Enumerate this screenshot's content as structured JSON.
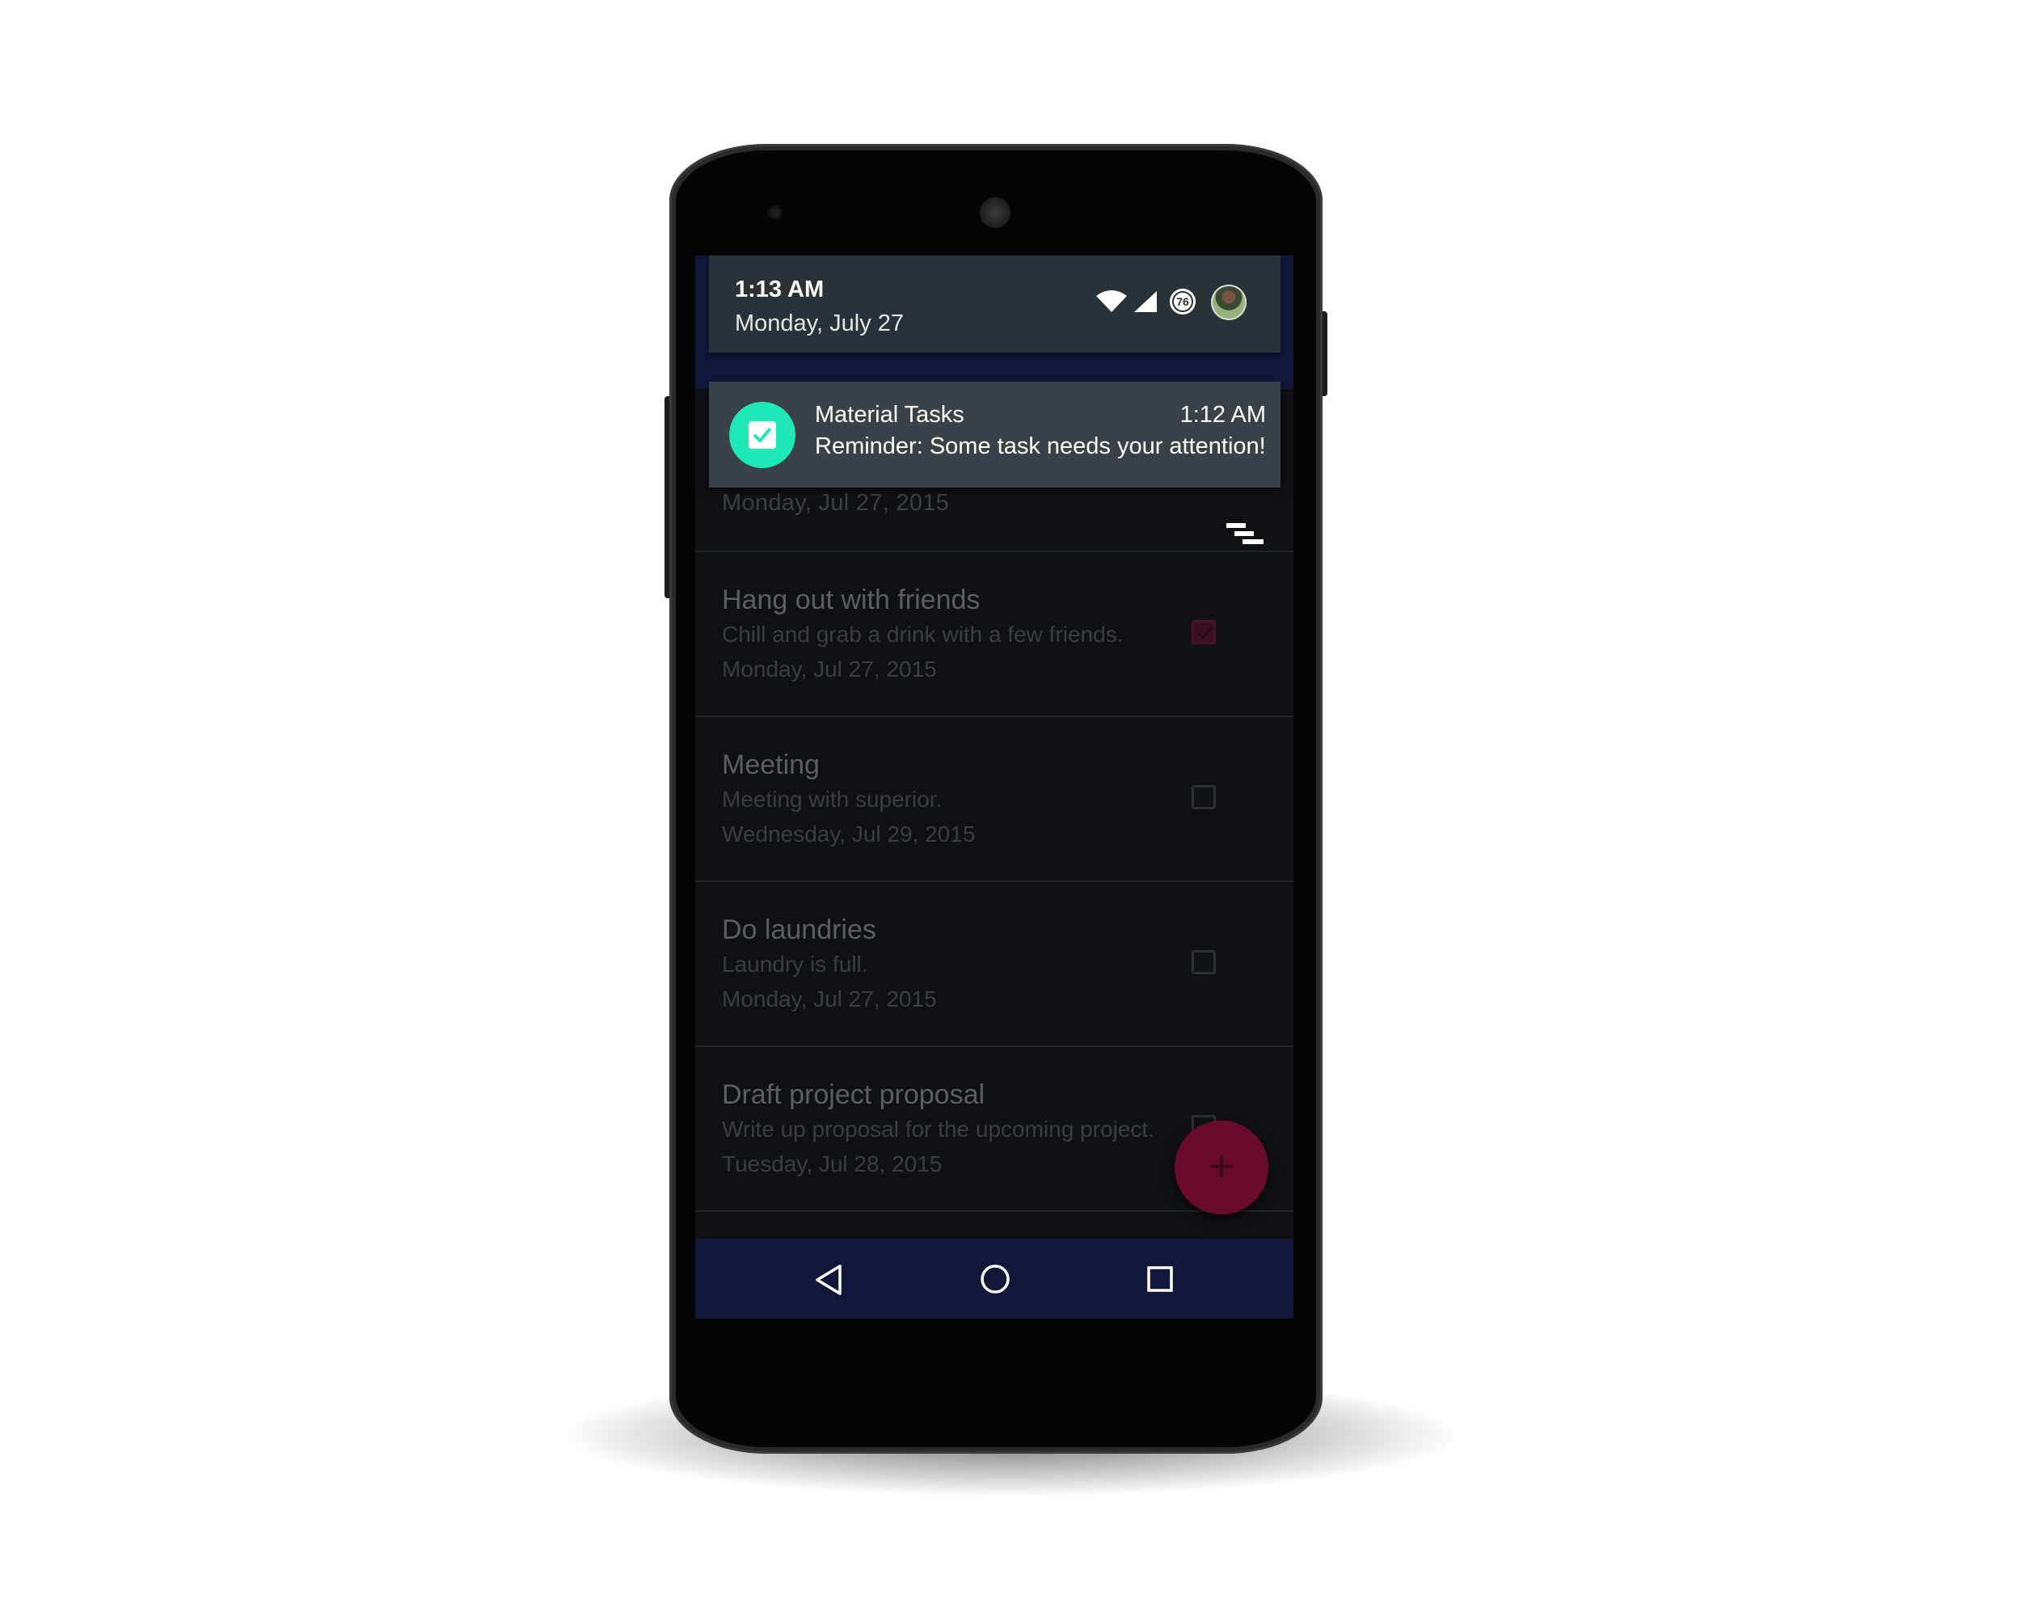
{
  "status_header": {
    "time": "1:13 AM",
    "date": "Monday, July 27",
    "battery_level": "76",
    "icons": [
      "wifi-icon",
      "cell-signal-icon",
      "battery-icon",
      "user-avatar"
    ]
  },
  "notification": {
    "app_name": "Material Tasks",
    "time": "1:12 AM",
    "text": "Reminder: Some task needs your attention!",
    "icon": "checkbox-icon",
    "accent_color": "#1de9b6"
  },
  "task_list": {
    "partial_date": "Monday, Jul 27, 2015",
    "sort_icon": "sort-icon",
    "tasks": [
      {
        "title": "Hang out with friends",
        "description": "Chill and grab a drink with a few friends.",
        "date": "Monday, Jul 27, 2015",
        "checked": true
      },
      {
        "title": "Meeting",
        "description": "Meeting with superior.",
        "date": "Wednesday, Jul 29, 2015",
        "checked": false
      },
      {
        "title": "Do laundries",
        "description": "Laundry is full.",
        "date": "Monday, Jul 27, 2015",
        "checked": false
      },
      {
        "title": "Draft project proposal",
        "description": "Write up proposal for the upcoming project.",
        "date": "Tuesday, Jul 28, 2015",
        "checked": false
      }
    ]
  },
  "fab": {
    "label": "+",
    "color": "#6a0a2c"
  },
  "navbar": {
    "icons": [
      "back-icon",
      "home-icon",
      "recents-icon"
    ],
    "color": "#12173a"
  }
}
